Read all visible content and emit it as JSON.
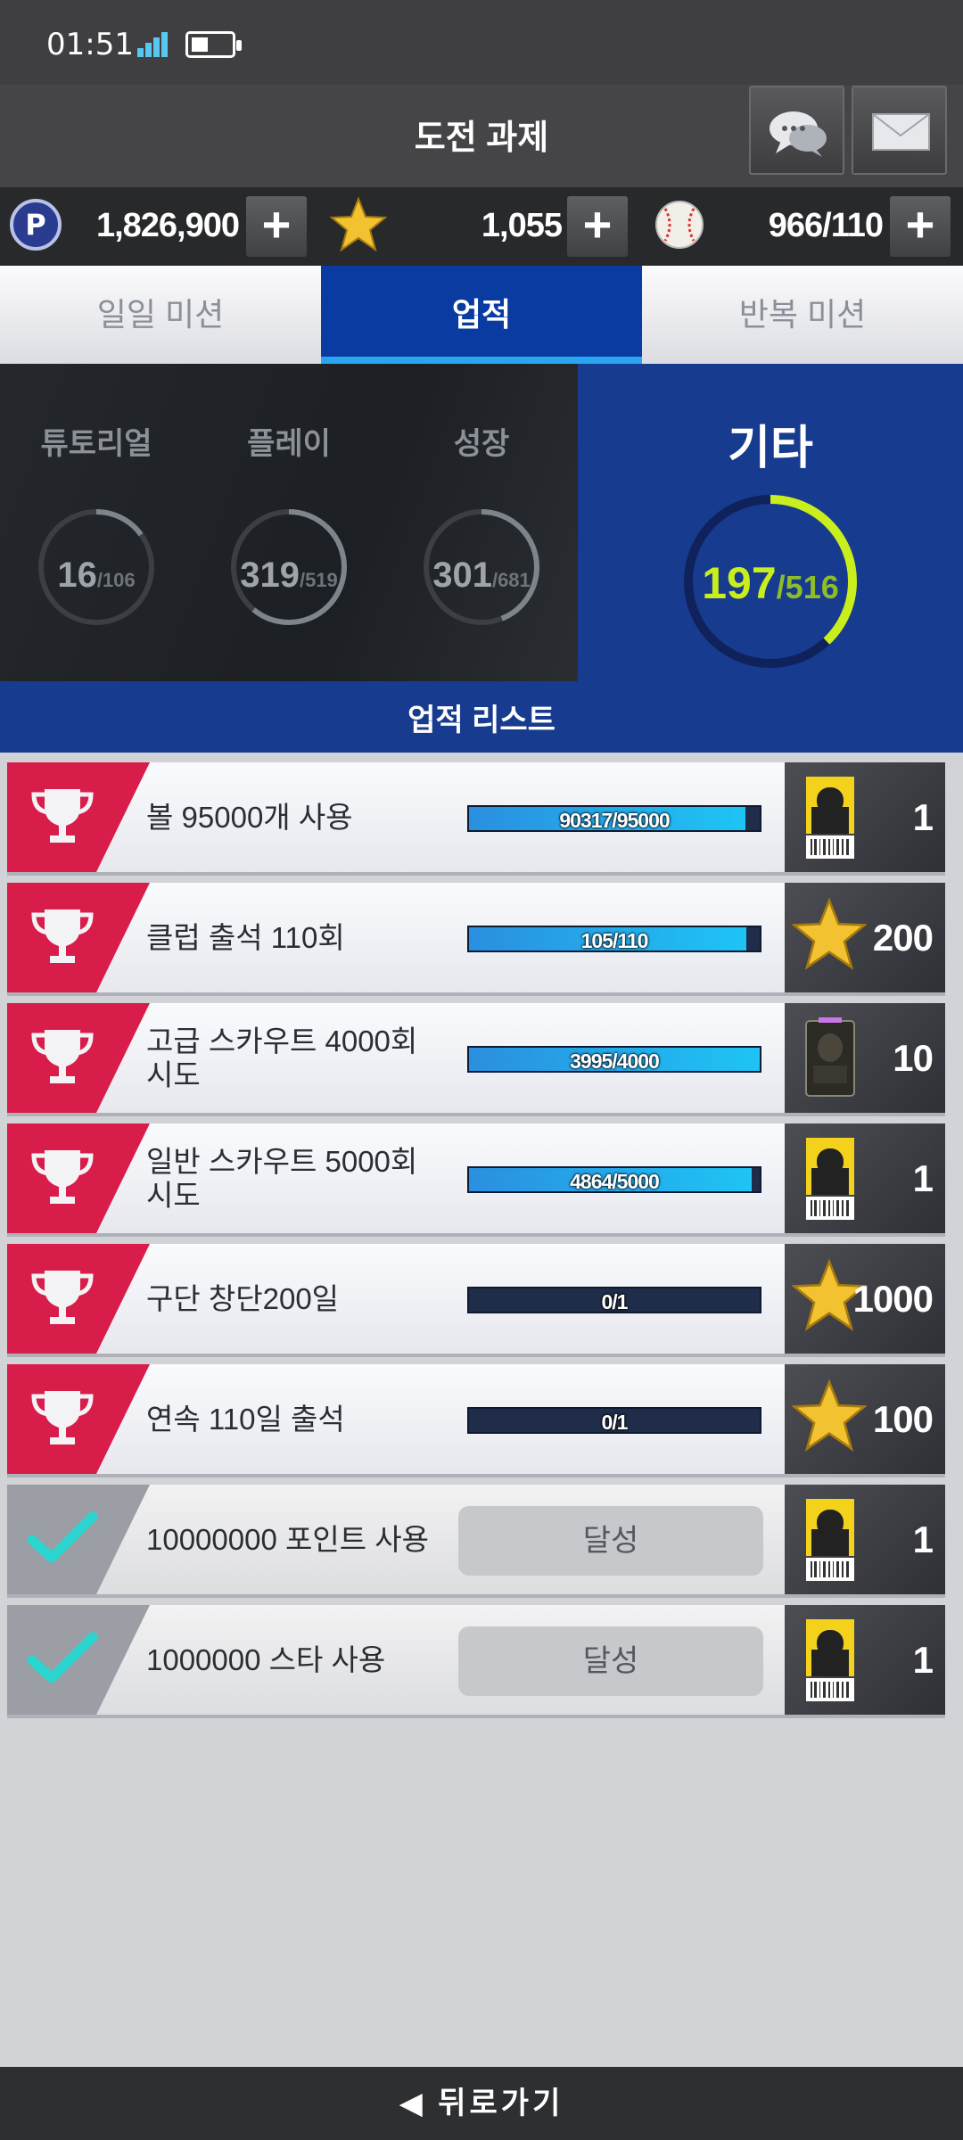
{
  "status": {
    "time": "01:51"
  },
  "header": {
    "title": "도전 과제"
  },
  "currency": {
    "points": "1,826,900",
    "stars": "1,055",
    "balls": "966/110",
    "plus_label": "+"
  },
  "tabs": [
    {
      "label": "일일 미션"
    },
    {
      "label": "업적"
    },
    {
      "label": "반복 미션"
    }
  ],
  "categories": {
    "items": [
      {
        "name": "튜토리얼",
        "current": "16",
        "total": "/106",
        "progress": 0.15
      },
      {
        "name": "플레이",
        "current": "319",
        "total": "/519",
        "progress": 0.61
      },
      {
        "name": "성장",
        "current": "301",
        "total": "/681",
        "progress": 0.44
      }
    ],
    "active": {
      "name": "기타",
      "current": "197",
      "total": "/516",
      "progress": 0.38
    },
    "list_label": "업적 리스트"
  },
  "achievements": [
    {
      "name": "볼 95000개 사용",
      "progress_text": "90317/95000",
      "progress": 0.95,
      "reward_icon": "player-card-icon",
      "reward_value": "1",
      "completed": false
    },
    {
      "name": "클럽 출석 110회",
      "progress_text": "105/110",
      "progress": 0.955,
      "reward_icon": "star-icon",
      "reward_value": "200",
      "completed": false
    },
    {
      "name": "고급 스카우트 4000회 시도",
      "progress_text": "3995/4000",
      "progress": 0.999,
      "reward_icon": "scout-card-icon",
      "reward_value": "10",
      "completed": false
    },
    {
      "name": "일반 스카우트 5000회 시도",
      "progress_text": "4864/5000",
      "progress": 0.973,
      "reward_icon": "player-card-icon",
      "reward_value": "1",
      "completed": false
    },
    {
      "name": "구단 창단200일",
      "progress_text": "0/1",
      "progress": 0,
      "reward_icon": "star-icon",
      "reward_value": "1000",
      "completed": false
    },
    {
      "name": "연속 110일 출석",
      "progress_text": "0/1",
      "progress": 0,
      "reward_icon": "star-icon",
      "reward_value": "100",
      "completed": false
    },
    {
      "name": "10000000 포인트 사용",
      "status_label": "달성",
      "reward_icon": "player-card-icon",
      "reward_value": "1",
      "completed": true
    },
    {
      "name": "1000000 스타 사용",
      "status_label": "달성",
      "reward_icon": "player-card-icon",
      "reward_value": "1",
      "completed": true
    }
  ],
  "footer": {
    "back_label": "◀ 뒤로가기"
  },
  "colors": {
    "accent_blue": "#0a3ba0",
    "badge_red": "#d81d4a",
    "check_teal": "#2ad6cf",
    "progress_cyan": "#1ec4f5",
    "ring_lime": "#c8ee1e"
  }
}
